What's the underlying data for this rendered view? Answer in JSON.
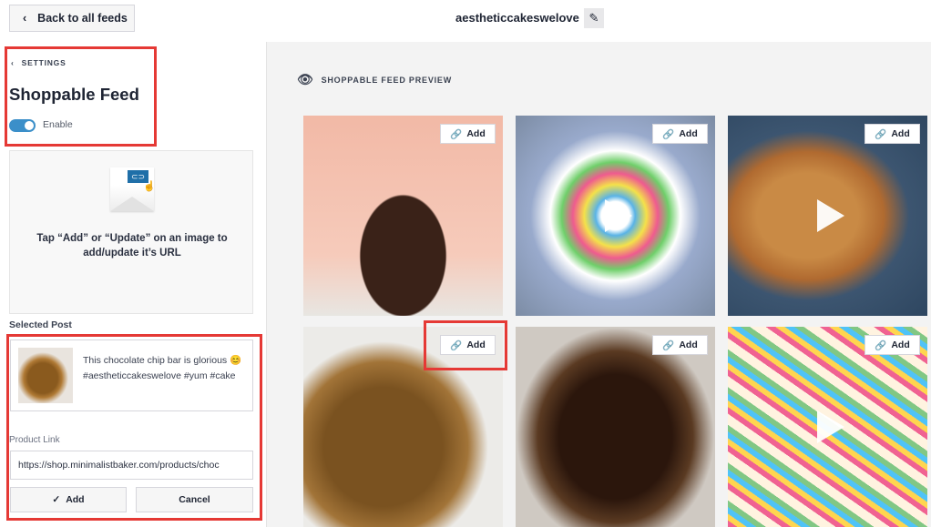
{
  "header": {
    "back_label": "Back to all feeds",
    "feed_name": "aestheticcakeswelove"
  },
  "sidebar": {
    "settings_label": "SETTINGS",
    "title": "Shoppable Feed",
    "enable_label": "Enable",
    "enabled": true,
    "hint": "Tap “Add” or “Update” on an image to add/update it’s URL",
    "selected_post_label": "Selected Post",
    "selected_post_caption": "This chocolate chip bar is glorious 😊 #aestheticcakeswelove #yum #cake",
    "product_link_label": "Product Link",
    "product_link_value": "https://shop.minimalistbaker.com/products/choc",
    "add_label": "Add",
    "cancel_label": "Cancel"
  },
  "preview": {
    "label": "SHOPPABLE FEED PREVIEW",
    "add_label": "Add",
    "tiles": [
      {
        "desc": "chocolate layer cake with 10 candles",
        "video": false
      },
      {
        "desc": "rainbow swirl roll cake",
        "video": true
      },
      {
        "desc": "crumble pie with custard",
        "video": true
      },
      {
        "desc": "chocolate chip bar",
        "video": false
      },
      {
        "desc": "chocolate pecan lava cake",
        "video": false
      },
      {
        "desc": "sprinkle donut cake",
        "video": true
      }
    ]
  },
  "colors": {
    "accent": "#3b8fc9",
    "highlight": "#e53935"
  }
}
